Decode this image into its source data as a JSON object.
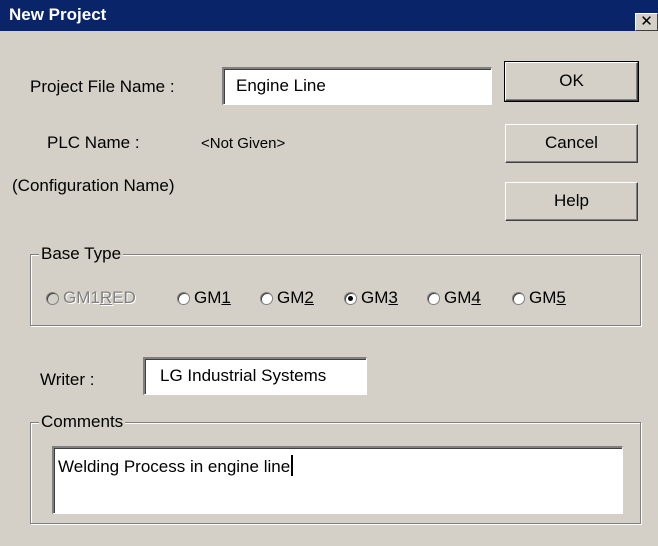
{
  "window": {
    "title": "New Project",
    "close_glyph": "✕"
  },
  "project_file": {
    "label": "Project File Name :",
    "value": "Engine Line"
  },
  "plc": {
    "label": "PLC Name :",
    "value": "<Not Given>",
    "sublabel": "(Configuration Name)"
  },
  "buttons": {
    "ok": "OK",
    "cancel": "Cancel",
    "help": "Help"
  },
  "base_type": {
    "title": "Base Type",
    "options": [
      {
        "pre": "GM1",
        "ul": "R",
        "post": "ED",
        "checked": false,
        "disabled": true
      },
      {
        "pre": "GM",
        "ul": "1",
        "post": "",
        "checked": false,
        "disabled": false
      },
      {
        "pre": "GM",
        "ul": "2",
        "post": "",
        "checked": false,
        "disabled": false
      },
      {
        "pre": "GM",
        "ul": "3",
        "post": "",
        "checked": true,
        "disabled": false
      },
      {
        "pre": "GM",
        "ul": "4",
        "post": "",
        "checked": false,
        "disabled": false
      },
      {
        "pre": "GM",
        "ul": "5",
        "post": "",
        "checked": false,
        "disabled": false
      }
    ]
  },
  "writer": {
    "label": "Writer :",
    "value": "LG Industrial Systems"
  },
  "comments": {
    "title": "Comments",
    "value": "Welding Process in engine line"
  }
}
